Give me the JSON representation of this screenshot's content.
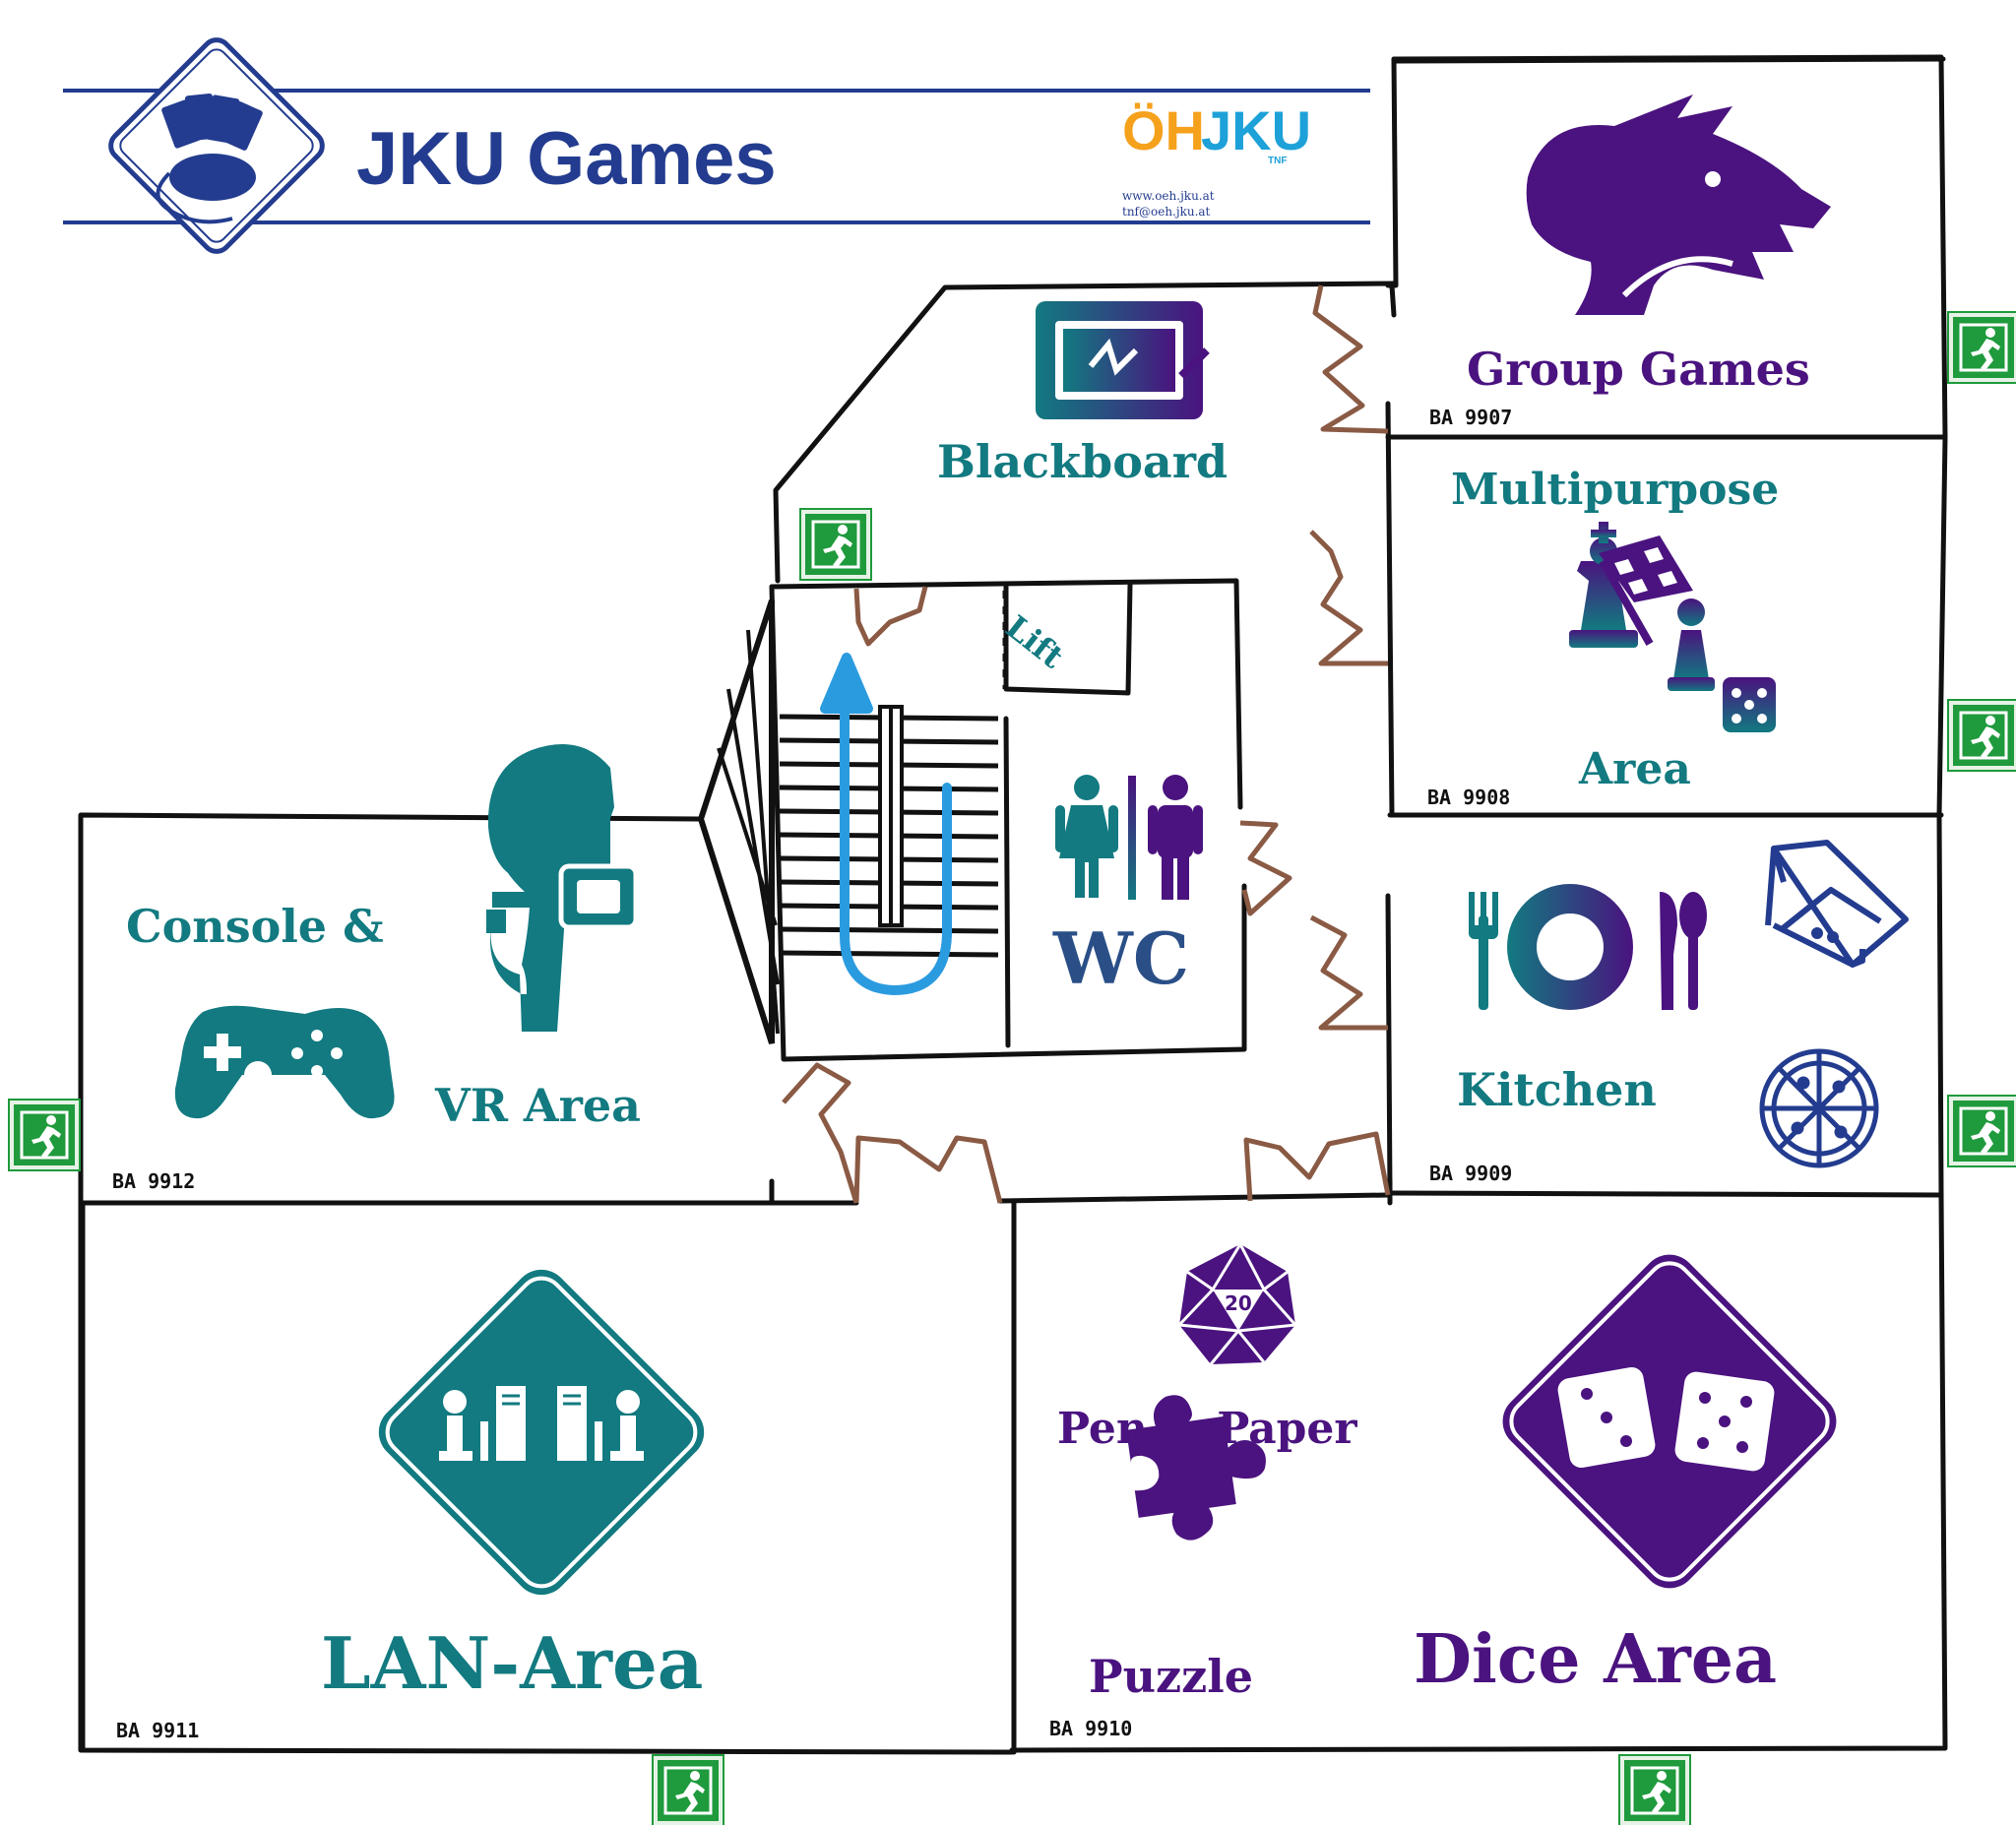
{
  "header": {
    "title": "JKU Games",
    "logo": {
      "oh": "ÖH",
      "jku": "JKU",
      "tnf": "TNF",
      "web": "www.oeh.jku.at",
      "email": "tnf@oeh.jku.at"
    }
  },
  "rooms": [
    {
      "key": "group-games",
      "name": "Group Games",
      "code": "BA 9907",
      "icon": "wolf-icon"
    },
    {
      "key": "multipurpose",
      "name_top": "Multipurpose",
      "name_bottom": "Area",
      "code": "BA 9908",
      "icon": "chess-flag-dice-icon"
    },
    {
      "key": "kitchen",
      "name": "Kitchen",
      "code": "BA 9909",
      "icon": "cutlery-plate-icon"
    },
    {
      "key": "dice",
      "name": "Dice Area",
      "code": "BA 9910",
      "icon": "dice-icon"
    },
    {
      "key": "lan",
      "name": "LAN-Area",
      "code": "BA 9911",
      "icon": "lan-computers-icon"
    },
    {
      "key": "console-vr",
      "name_top": "Console &",
      "name_bottom": "VR Area",
      "code": "BA 9912",
      "icon": "vr-gamepad-icon"
    }
  ],
  "labels": {
    "blackboard": "Blackboard",
    "lift": "Lift",
    "wc": "WC",
    "pen_paper": "Pen & Paper",
    "puzzle": "Puzzle",
    "d20": "20"
  },
  "colors": {
    "teal": "#127a80",
    "purple": "#4a137f",
    "navy": "#233c8f",
    "door": "#8a5a44",
    "exit_green": "#1f9a3c",
    "stairs_arrow": "#2b9be0"
  },
  "exit_sign_icon": "emergency-exit-icon",
  "exit_count": 8
}
